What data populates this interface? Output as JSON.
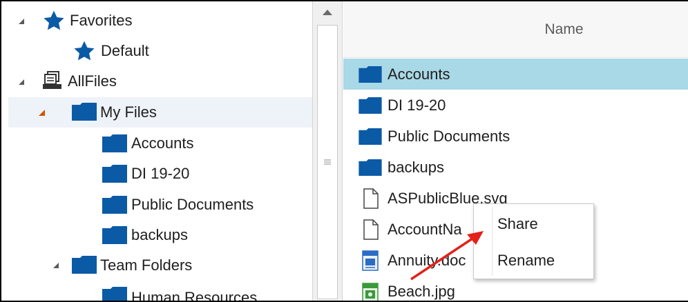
{
  "tree": {
    "favorites_label": "Favorites",
    "default_label": "Default",
    "allfiles_label": "AllFiles",
    "myfiles_label": "My Files",
    "myfiles_children": [
      "Accounts",
      "DI 19-20",
      "Public Documents",
      "backups"
    ],
    "teamfolders_label": "Team Folders",
    "teamfolders_children": [
      "Human Resources"
    ]
  },
  "list": {
    "column_header": "Name",
    "items": [
      {
        "name": "Accounts",
        "type": "folder"
      },
      {
        "name": "DI 19-20",
        "type": "folder"
      },
      {
        "name": "Public Documents",
        "type": "folder"
      },
      {
        "name": "backups",
        "type": "folder"
      },
      {
        "name": "ASPublicBlue.svg",
        "type": "file"
      },
      {
        "name": "AccountNa",
        "type": "file"
      },
      {
        "name": "Annuity.doc",
        "type": "docx"
      },
      {
        "name": "Beach.jpg",
        "type": "jpg"
      }
    ]
  },
  "context_menu": {
    "share_label": "Share",
    "rename_label": "Rename"
  },
  "icons": {
    "favorites": "star-icon",
    "allfiles": "file-stack-icon",
    "folder": "folder-icon",
    "file": "file-icon",
    "docx": "word-document-icon",
    "jpg": "image-file-icon",
    "scroll_up": "arrow-up-icon",
    "scroll_grip": "grip-lines-icon"
  },
  "colors": {
    "folder": "#0b5aa6",
    "selected_row": "#a9d8e6",
    "tree_selected_row": "#eef3f9",
    "annotation_arrow": "#e32219",
    "expand_arrow_active": "#d35400"
  }
}
